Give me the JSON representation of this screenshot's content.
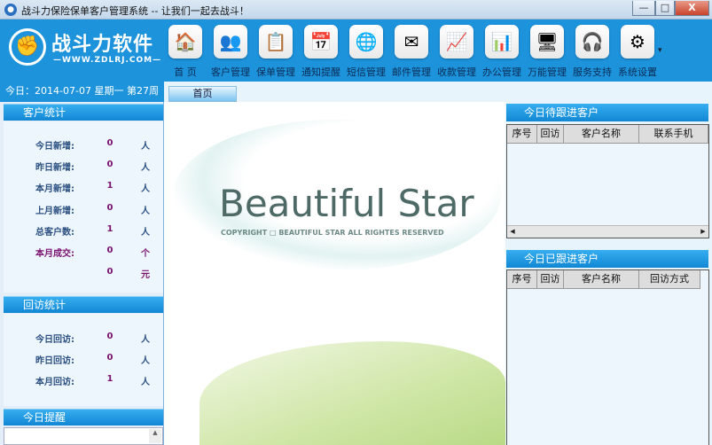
{
  "window": {
    "title": "战斗力保险保单客户管理系统 -- 让我们一起去战斗！",
    "minimize": "—",
    "maximize": "□",
    "close": "X"
  },
  "logo": {
    "name": "战斗力软件",
    "url": "—WWW.ZDLRJ.COM—",
    "icon": "fist-icon"
  },
  "date": "今日：2014-07-07 星期一 第27周",
  "toolbar": [
    {
      "label": "首 页",
      "icon": "🏠"
    },
    {
      "label": "客户管理",
      "icon": "👥"
    },
    {
      "label": "保单管理",
      "icon": "📋"
    },
    {
      "label": "通知提醒",
      "icon": "📅"
    },
    {
      "label": "短信管理",
      "icon": "🌐"
    },
    {
      "label": "邮件管理",
      "icon": "✉"
    },
    {
      "label": "收款管理",
      "icon": "📈"
    },
    {
      "label": "办公管理",
      "icon": "📊"
    },
    {
      "label": "万能管理",
      "icon": "🖥"
    },
    {
      "label": "服务支持",
      "icon": "🎧"
    },
    {
      "label": "系统设置",
      "icon": "⚙"
    }
  ],
  "toolbar_more": "▾",
  "tab": "首页",
  "customer_stats": {
    "title": "客户统计",
    "rows": [
      {
        "label": "今日新增:",
        "value": "0",
        "unit": "人"
      },
      {
        "label": "昨日新增:",
        "value": "0",
        "unit": "人"
      },
      {
        "label": "本月新增:",
        "value": "1",
        "unit": "人"
      },
      {
        "label": "上月新增:",
        "value": "0",
        "unit": "人"
      },
      {
        "label": "总客户数:",
        "value": "1",
        "unit": "人"
      },
      {
        "label": "本月成交:",
        "value": "0",
        "unit": "个"
      },
      {
        "label": "",
        "value": "0",
        "unit": "元"
      }
    ]
  },
  "visit_stats": {
    "title": "回访统计",
    "rows": [
      {
        "label": "今日回访:",
        "value": "0",
        "unit": "人"
      },
      {
        "label": "昨日回访:",
        "value": "0",
        "unit": "人"
      },
      {
        "label": "本月回访:",
        "value": "1",
        "unit": "人"
      }
    ]
  },
  "reminder": {
    "title": "今日提醒"
  },
  "banner": {
    "title": "Beautiful Star",
    "copyright": "COPYRIGHT □ BEAUTIFUL STAR ALL RIGHTES RESERVED"
  },
  "pending": {
    "title": "今日待跟进客户",
    "columns": [
      "序号",
      "回访",
      "客户名称",
      "联系手机"
    ]
  },
  "followed": {
    "title": "今日已跟进客户",
    "columns": [
      "序号",
      "回访",
      "客户名称",
      "回访方式"
    ]
  },
  "colors": {
    "accent": "#1d93dc",
    "value": "#7a1070",
    "label": "#2a4f80"
  }
}
